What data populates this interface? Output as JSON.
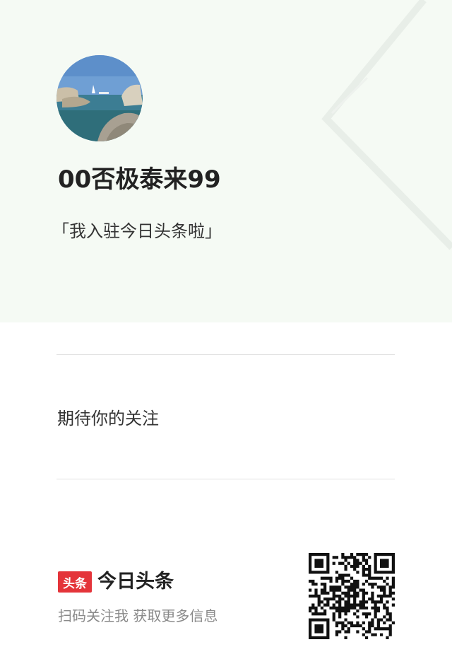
{
  "profile": {
    "username": "00否极泰来99",
    "bio": "「我入驻今日头条啦」"
  },
  "follow": {
    "text": "期待你的关注"
  },
  "brand": {
    "logo_text": "头条",
    "name": "今日头条",
    "scan_text": "扫码关注我 获取更多信息"
  },
  "colors": {
    "top_background": "#f5faf4",
    "brand_red": "#e4343a",
    "divider": "#e2e2e2",
    "muted_text": "#8a8a8a"
  },
  "icons": {
    "brand_logo": "toutiao-logo-icon",
    "qr": "qr-code-icon",
    "avatar": "avatar-seascape-photo"
  }
}
